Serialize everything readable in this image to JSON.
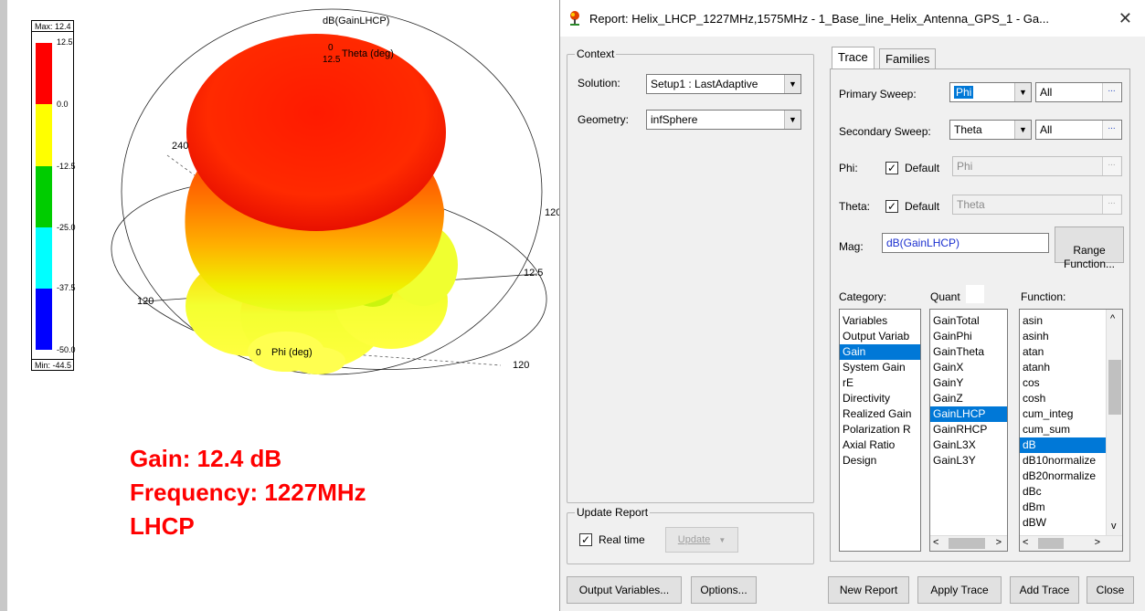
{
  "plot": {
    "title": "dB(GainLHCP)",
    "legend": {
      "max_label": "Max: 12.4",
      "min_label": "Min: -44.5",
      "ticks": [
        "12.5",
        "0.0",
        "-12.5",
        "-25.0",
        "-37.5",
        "-50.0"
      ],
      "colors": [
        "#ff0000",
        "#ffff00",
        "#00cc00",
        "#00ffff",
        "#0000ff"
      ]
    },
    "axis_labels": {
      "theta": "Theta (deg)",
      "phi": "Phi (deg)",
      "zero_top": "0",
      "zero_phi": "0",
      "r_top": "12.5",
      "r_right": "12.5",
      "a240": "240",
      "a120_right": "120",
      "a120_left": "120",
      "a120_bottom": "120"
    },
    "annotation": {
      "line1": "Gain: 12.4 dB",
      "line2": "Frequency: 1227MHz",
      "line3": "LHCP"
    }
  },
  "dialog": {
    "title": "Report: Helix_LHCP_1227MHz,1575MHz - 1_Base_line_Helix_Antenna_GPS_1 - Ga...",
    "close_symbol": "✕",
    "context": {
      "legend": "Context",
      "solution_label": "Solution:",
      "solution_value": "Setup1 : LastAdaptive",
      "geometry_label": "Geometry:",
      "geometry_value": "infSphere"
    },
    "update": {
      "legend": "Update Report",
      "realtime_label": "Real time",
      "realtime_checked": "✓",
      "update_button": "Update"
    },
    "tabs": [
      "Trace",
      "Families"
    ],
    "trace": {
      "primary_sweep_label": "Primary Sweep:",
      "primary_sweep_value": "Phi",
      "primary_sweep_range": "All",
      "secondary_sweep_label": "Secondary Sweep:",
      "secondary_sweep_value": "Theta",
      "secondary_sweep_range": "All",
      "phi_label": "Phi:",
      "phi_default_label": "Default",
      "phi_value": "Phi",
      "theta_label": "Theta:",
      "theta_default_label": "Default",
      "theta_value": "Theta",
      "mag_label": "Mag:",
      "mag_value": "dB(GainLHCP)",
      "range_function_button": "Range\nFunction...",
      "ellipsis": "...",
      "checkmark": "✓"
    },
    "category": {
      "label": "Category:",
      "items": [
        "Variables",
        "Output Variab",
        "Gain",
        "System Gain",
        "rE",
        "Directivity",
        "Realized Gain",
        "Polarization R",
        "Axial Ratio",
        "Design"
      ],
      "selected": "Gain"
    },
    "quantity": {
      "label": "Quant",
      "items": [
        "GainTotal",
        "GainPhi",
        "GainTheta",
        "GainX",
        "GainY",
        "GainZ",
        "GainLHCP",
        "GainRHCP",
        "GainL3X",
        "GainL3Y"
      ],
      "selected": "GainLHCP"
    },
    "function": {
      "label": "Function:",
      "items": [
        "asin",
        "asinh",
        "atan",
        "atanh",
        "cos",
        "cosh",
        "cum_integ",
        "cum_sum",
        "dB",
        "dB10normalize",
        "dB20normalize",
        "dBc",
        "dBm",
        "dBW"
      ],
      "selected": "dB"
    },
    "buttons": {
      "output_variables": "Output Variables...",
      "options": "Options...",
      "new_report": "New Report",
      "apply_trace": "Apply Trace",
      "add_trace": "Add Trace",
      "close": "Close"
    },
    "scroll": {
      "left": "<",
      "right": ">",
      "up": "^",
      "down": "v"
    }
  }
}
